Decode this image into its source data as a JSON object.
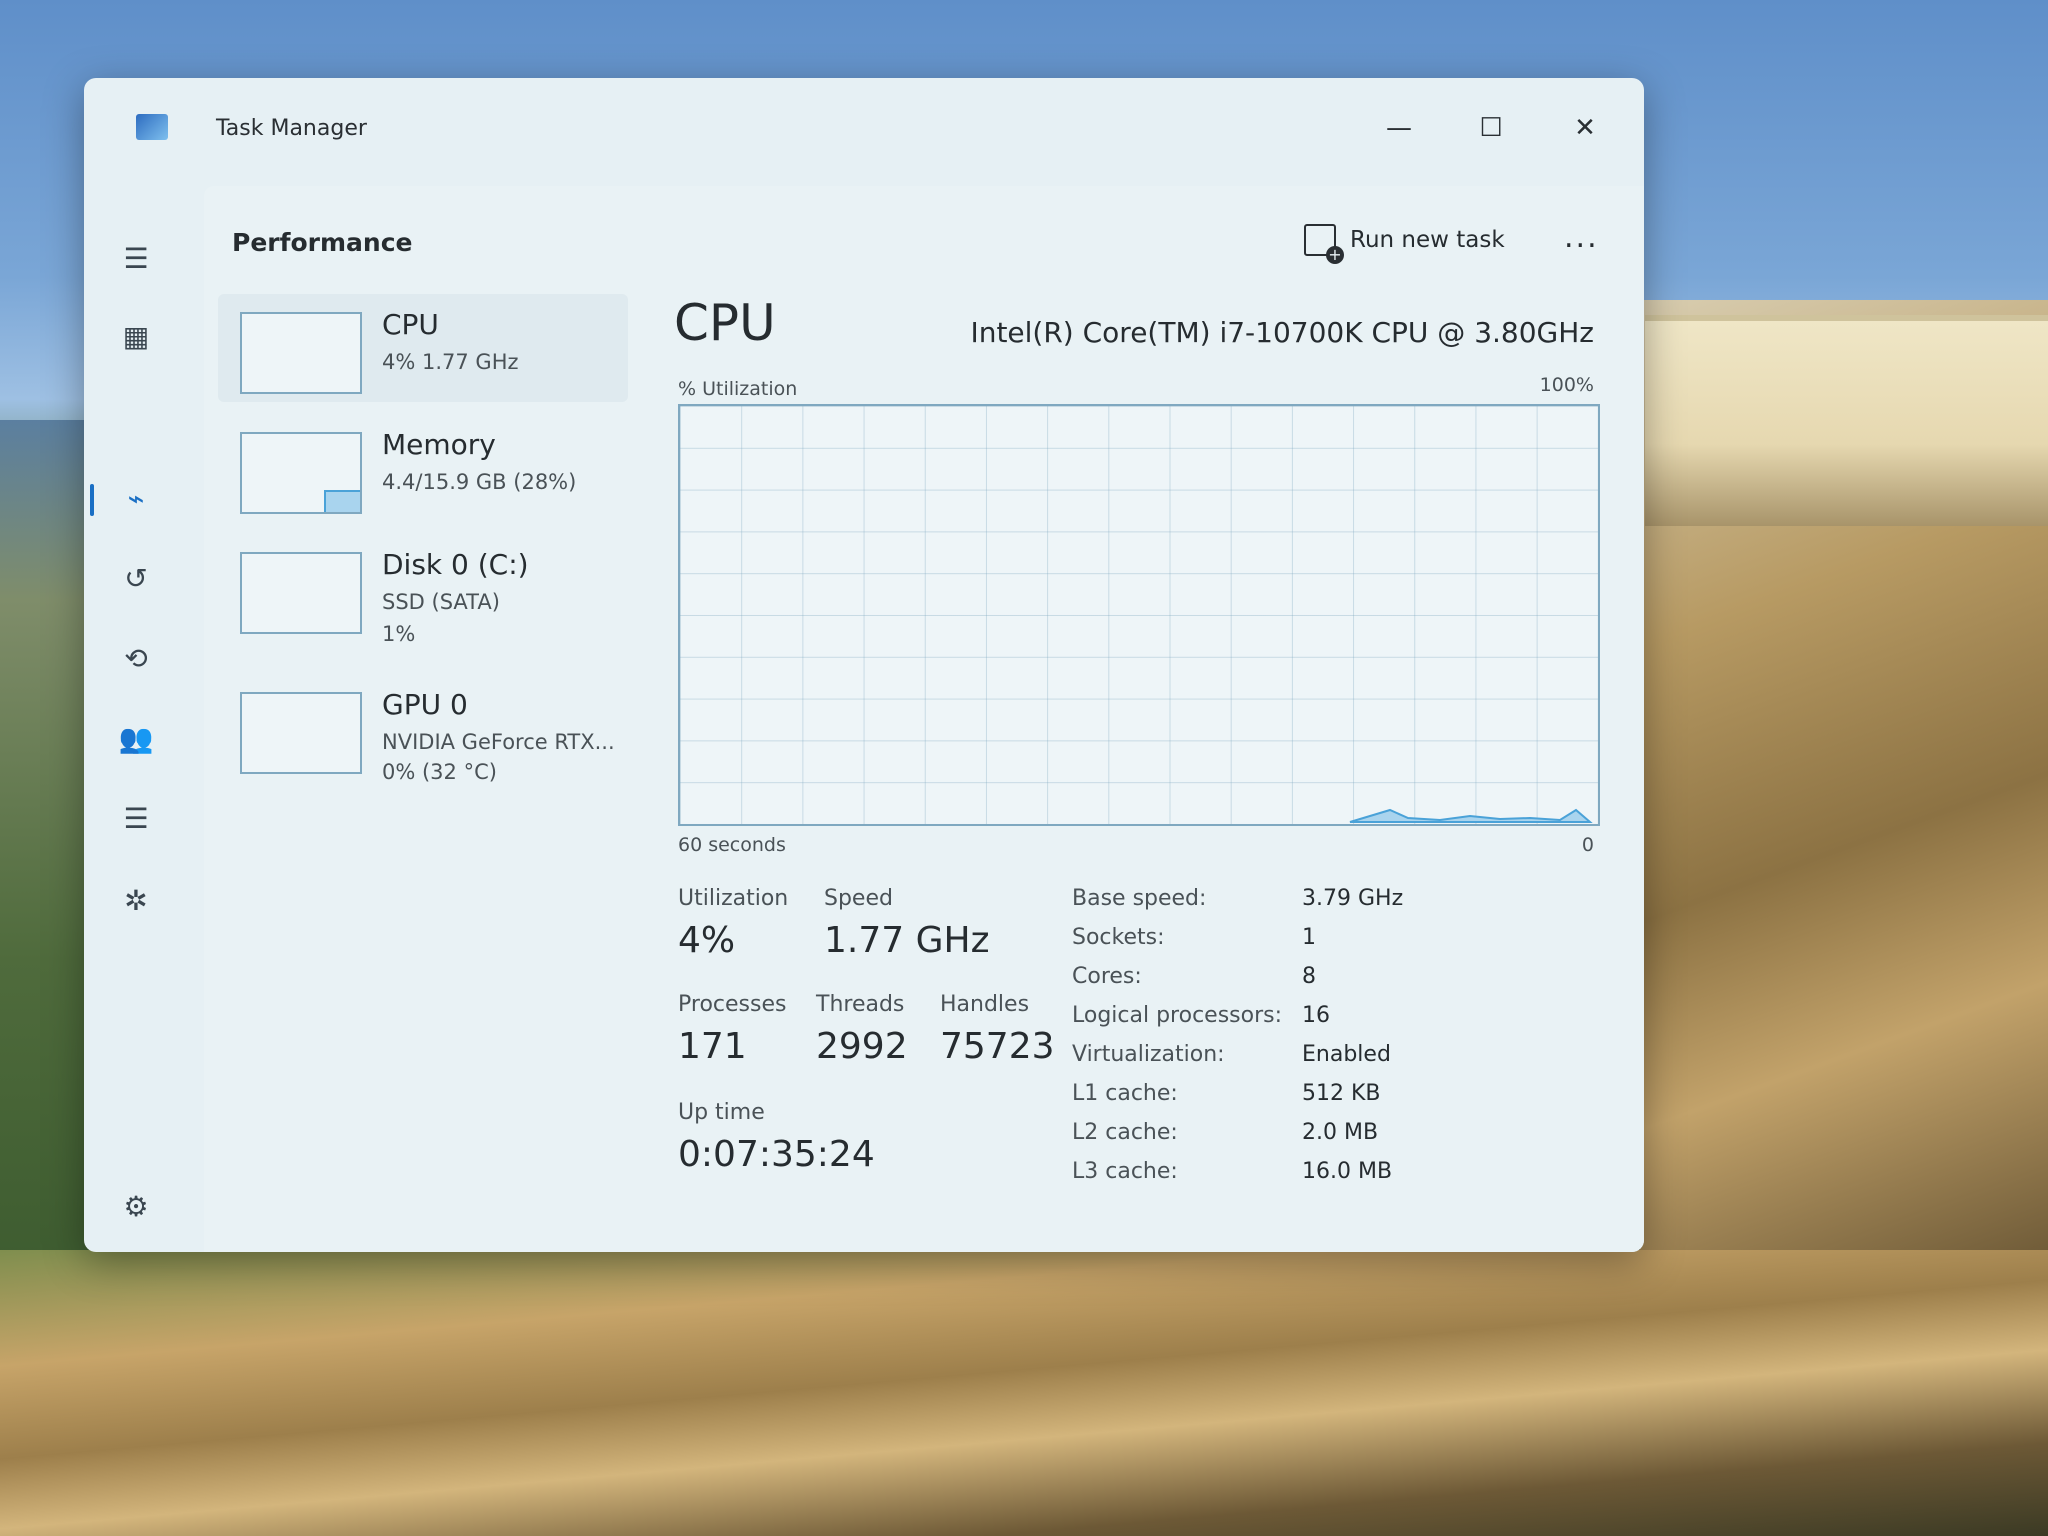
{
  "window": {
    "title": "Task Manager",
    "minimize_glyph": "—",
    "maximize_glyph": "☐",
    "close_glyph": "✕"
  },
  "nav": [
    {
      "icon": "hamburger-menu-icon",
      "glyph": "☰"
    },
    {
      "icon": "processes-icon",
      "glyph": "▦"
    },
    {
      "icon": "performance-icon",
      "glyph": "⌁"
    },
    {
      "icon": "app-history-icon",
      "glyph": "↺"
    },
    {
      "icon": "startup-apps-icon",
      "glyph": "⟲"
    },
    {
      "icon": "users-icon",
      "glyph": "👥"
    },
    {
      "icon": "details-icon",
      "glyph": "☰"
    },
    {
      "icon": "services-icon",
      "glyph": "✲"
    },
    {
      "icon": "settings-icon",
      "glyph": "⚙"
    }
  ],
  "header": {
    "title": "Performance",
    "run_new_task": "Run new task",
    "more": "..."
  },
  "devices": [
    {
      "name": "CPU",
      "line1": "4%  1.77 GHz",
      "line2": ""
    },
    {
      "name": "Memory",
      "line1": "4.4/15.9 GB (28%)",
      "line2": ""
    },
    {
      "name": "Disk 0 (C:)",
      "line1": "SSD (SATA)",
      "line2": "1%"
    },
    {
      "name": "GPU 0",
      "line1": "NVIDIA GeForce RTX...",
      "line2": "0%  (32 °C)"
    }
  ],
  "detail": {
    "heading": "CPU",
    "model": "Intel(R) Core(TM) i7-10700K CPU @ 3.80GHz",
    "graph_label": "% Utilization",
    "graph_max": "100%",
    "graph_time": "60 seconds",
    "graph_zero": "0",
    "utilization_label": "Utilization",
    "utilization_value": "4%",
    "speed_label": "Speed",
    "speed_value": "1.77 GHz",
    "processes_label": "Processes",
    "processes_value": "171",
    "threads_label": "Threads",
    "threads_value": "2992",
    "handles_label": "Handles",
    "handles_value": "75723",
    "uptime_label": "Up time",
    "uptime_value": "0:07:35:24"
  },
  "specs": [
    {
      "label": "Base speed:",
      "value": "3.79 GHz"
    },
    {
      "label": "Sockets:",
      "value": "1"
    },
    {
      "label": "Cores:",
      "value": "8"
    },
    {
      "label": "Logical processors:",
      "value": "16"
    },
    {
      "label": "Virtualization:",
      "value": "Enabled"
    },
    {
      "label": "L1 cache:",
      "value": "512 KB"
    },
    {
      "label": "L2 cache:",
      "value": "2.0 MB"
    },
    {
      "label": "L3 cache:",
      "value": "16.0 MB"
    }
  ],
  "colors": {
    "accent": "#1a6fc4",
    "graph_line": "#4aa2d8",
    "graph_fill": "#a9d4ee"
  }
}
